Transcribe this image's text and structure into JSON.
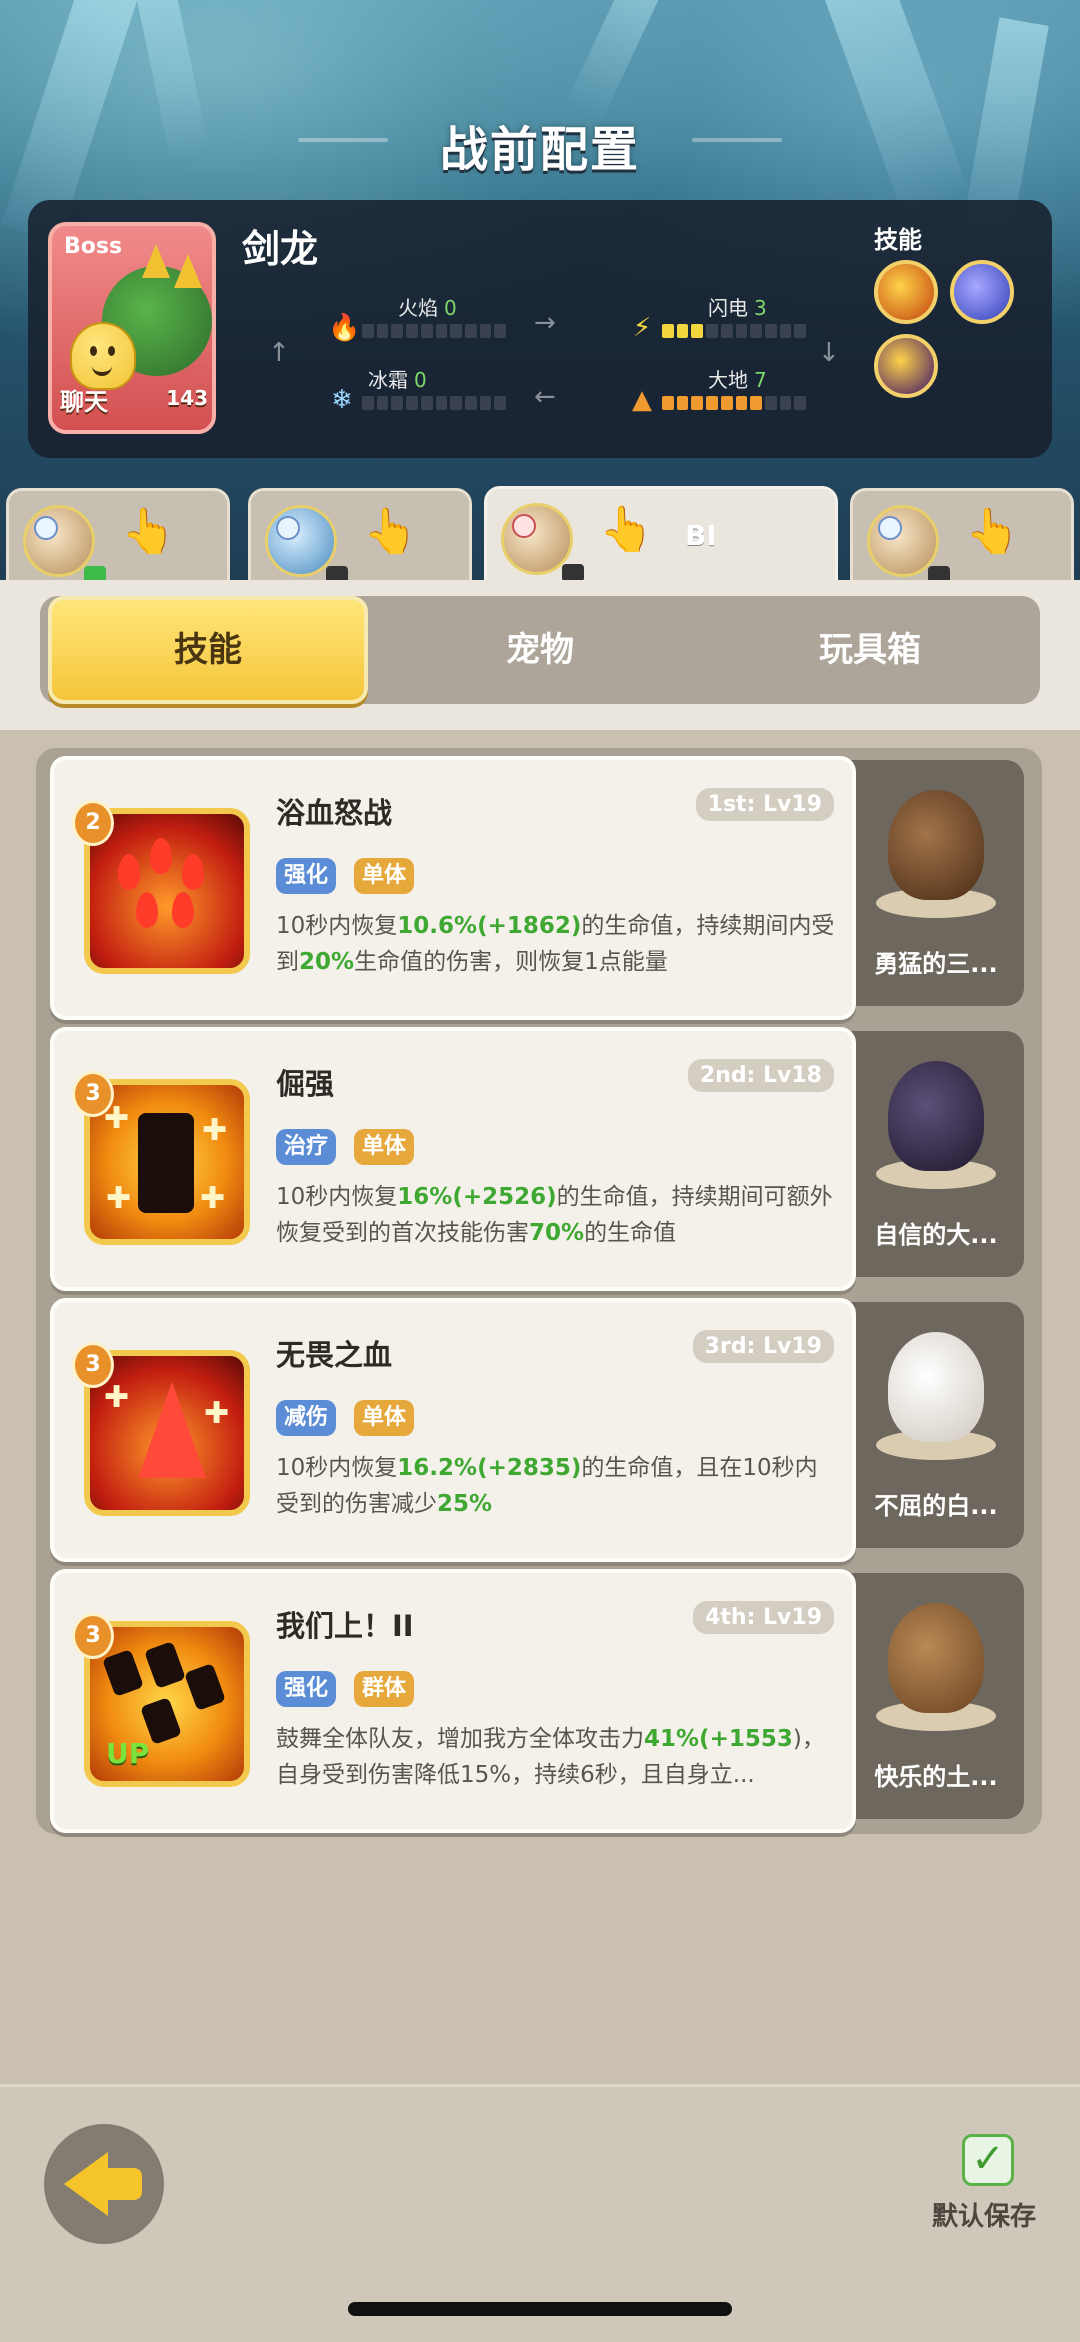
{
  "header": {
    "title": "战前配置"
  },
  "boss": {
    "tag": "Boss",
    "name": "剑龙",
    "chat_label": "聊天",
    "power": "143",
    "elements": [
      {
        "label": "火焰",
        "value": "0",
        "filled": 0,
        "color": "#ff5a3a"
      },
      {
        "label": "闪电",
        "value": "3",
        "filled": 3,
        "color": "#f2d640"
      },
      {
        "label": "冰霜",
        "value": "0",
        "filled": 0,
        "color": "#9ad8ff"
      },
      {
        "label": "大地",
        "value": "7",
        "filled": 7,
        "color": "#f09a30"
      }
    ],
    "skills_label": "技能"
  },
  "char_tabs": [
    {
      "active": false,
      "label": ""
    },
    {
      "active": false,
      "label": ""
    },
    {
      "active": true,
      "label": "BI"
    },
    {
      "active": false,
      "label": ""
    }
  ],
  "menu": {
    "tabs": [
      "技能",
      "宠物",
      "玩具箱"
    ],
    "active_index": 0
  },
  "skills": [
    {
      "badge": "2",
      "name": "浴血怒战",
      "lv": "1st: Lv19",
      "tags": [
        "强化",
        "单体"
      ],
      "desc": [
        "10秒内恢复",
        "10.6%(+1862)",
        "的生命值，持续期间内受到",
        "20%",
        "生命值的伤害，则恢复1点能量"
      ],
      "pet": "勇猛的三..."
    },
    {
      "badge": "3",
      "name": "倔强",
      "lv": "2nd: Lv18",
      "tags": [
        "治疗",
        "单体"
      ],
      "desc": [
        "10秒内恢复",
        "16%(+2526)",
        "的生命值，持续期间可额外恢复受到的首次技能伤害",
        "70%",
        "的生命值"
      ],
      "pet": "自信的大..."
    },
    {
      "badge": "3",
      "name": "无畏之血",
      "lv": "3rd: Lv19",
      "tags": [
        "减伤",
        "单体"
      ],
      "desc": [
        "10秒内恢复",
        "16.2%(+2835)",
        "的生命值，且在10秒内受到的伤害减少",
        "25%",
        ""
      ],
      "pet": "不屈的白..."
    },
    {
      "badge": "3",
      "name": "我们上！II",
      "lv": "4th: Lv19",
      "tags": [
        "强化",
        "群体"
      ],
      "desc": [
        "鼓舞全体队友，增加我方全体攻击力",
        "41%(+1553",
        ")，自身受到伤害降低15%，持续6秒，且自身立",
        "",
        "..."
      ],
      "pet": "快乐的土..."
    }
  ],
  "icon_names": {
    "up_tag": "UP"
  },
  "footer": {
    "save_label": "默认保存"
  }
}
